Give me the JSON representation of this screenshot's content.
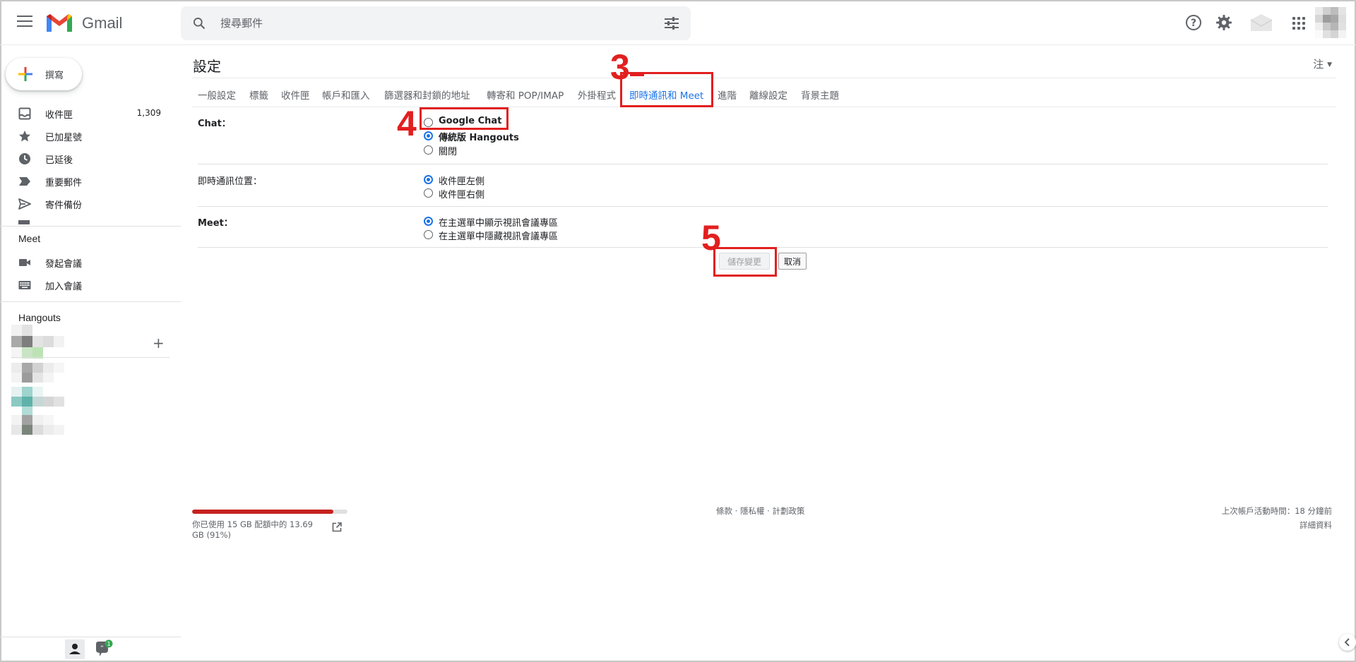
{
  "app": {
    "name": "Gmail",
    "brand_colors": {
      "red": "#EA4335",
      "blue": "#4285F4",
      "green": "#34A853",
      "yellow": "#FBBC04"
    }
  },
  "search": {
    "placeholder": "搜尋郵件"
  },
  "compose": {
    "label": "撰寫"
  },
  "sidebar": {
    "items": [
      {
        "label": "收件匣",
        "count": "1,309",
        "icon": "inbox-icon"
      },
      {
        "label": "已加星號",
        "icon": "star-icon"
      },
      {
        "label": "已延後",
        "icon": "clock-icon"
      },
      {
        "label": "重要郵件",
        "icon": "important-icon"
      },
      {
        "label": "寄件備份",
        "icon": "send-icon"
      }
    ],
    "meet": {
      "title": "Meet",
      "items": [
        {
          "label": "發起會議",
          "icon": "video-icon"
        },
        {
          "label": "加入會議",
          "icon": "keyboard-icon"
        }
      ]
    },
    "hangouts": {
      "title": "Hangouts"
    },
    "notifications": {
      "chat_badge": "1"
    }
  },
  "settings": {
    "title": "設定",
    "language_button": "注",
    "tabs": [
      {
        "label": "一般設定"
      },
      {
        "label": "標籤"
      },
      {
        "label": "收件匣"
      },
      {
        "label": "帳戶和匯入"
      },
      {
        "label": "篩選器和封鎖的地址"
      },
      {
        "label": "轉寄和 POP/IMAP"
      },
      {
        "label": "外掛程式"
      },
      {
        "label": "即時通訊和 Meet",
        "active": true
      },
      {
        "label": "進階"
      },
      {
        "label": "離線設定"
      },
      {
        "label": "背景主題"
      }
    ],
    "rows": [
      {
        "label": "Chat：",
        "options": [
          {
            "label": "Google Chat",
            "selected": false
          },
          {
            "label": "傳統版 Hangouts",
            "selected": true
          },
          {
            "label": "關閉",
            "selected": false
          }
        ]
      },
      {
        "label": "即時通訊位置：",
        "options": [
          {
            "label": "收件匣左側",
            "selected": true
          },
          {
            "label": "收件匣右側",
            "selected": false
          }
        ]
      },
      {
        "label": "Meet：",
        "options": [
          {
            "label": "在主選單中顯示視訊會議專區",
            "selected": true
          },
          {
            "label": "在主選單中隱藏視訊會議專區",
            "selected": false
          }
        ]
      }
    ],
    "buttons": {
      "save": "儲存變更",
      "cancel": "取消"
    }
  },
  "annotations": {
    "step3": "3",
    "step4": "4",
    "step5": "5",
    "color": "#E21F1F"
  },
  "footer": {
    "storage_percent": 91,
    "storage_text": "你已使用 15 GB 配額中的 13.69 GB (91%)",
    "links": {
      "terms": "條款",
      "privacy": "隱私權",
      "policies": "計劃政策",
      "sep": "·"
    },
    "last_activity": "上次帳戶活動時間：18 分鐘前",
    "details": "詳細資料"
  }
}
